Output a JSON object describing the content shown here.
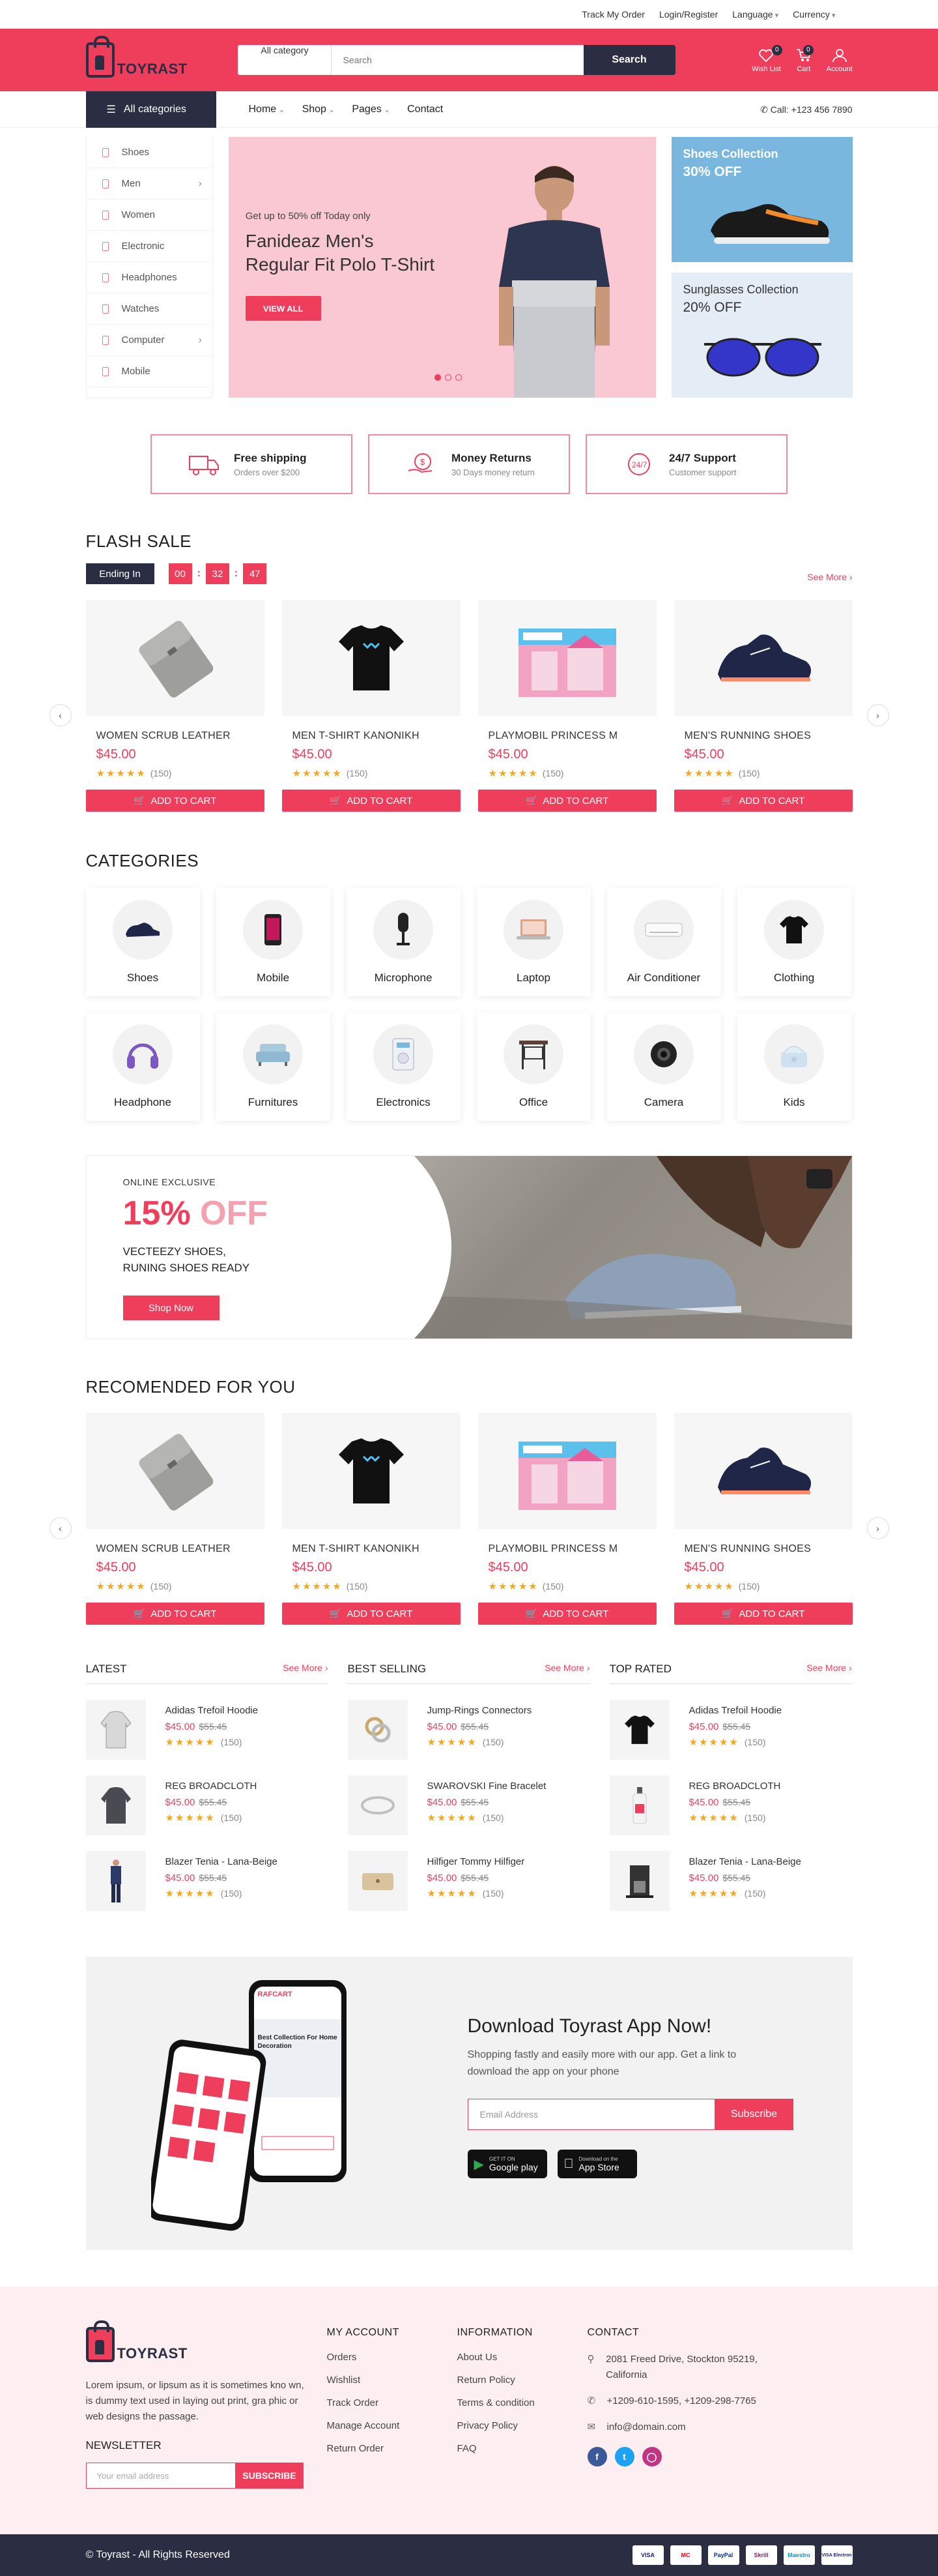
{
  "topbar": {
    "track": "Track My Order",
    "login": "Login/Register",
    "language": "Language",
    "currency": "Currency"
  },
  "header": {
    "brand": "TOYRAST",
    "category_label": "All category",
    "search_placeholder": "Search",
    "search_button": "Search",
    "wishlist_label": "Wish List",
    "wishlist_count": "0",
    "cart_label": "Cart",
    "cart_count": "0",
    "account_label": "Account"
  },
  "nav": {
    "all_categories": "All categories",
    "items": [
      "Home",
      "Shop",
      "Pages",
      "Contact"
    ],
    "call": "Call: +123 456 7890"
  },
  "sidebar": [
    "Shoes",
    "Men",
    "Women",
    "Electronic",
    "Headphones",
    "Watches",
    "Computer",
    "Mobile"
  ],
  "hero": {
    "subtitle": "Get up to 50% off Today only",
    "title": "Fanideaz Men's Regular Fit Polo T-Shirt",
    "button": "VIEW ALL"
  },
  "promos": [
    {
      "title": "Shoes Collection",
      "offer": "30% OFF"
    },
    {
      "title": "Sunglasses Collection",
      "offer": "20% OFF"
    }
  ],
  "services": [
    {
      "title": "Free shipping",
      "sub": "Orders over $200"
    },
    {
      "title": "Money Returns",
      "sub": "30 Days money return"
    },
    {
      "title": "24/7 Support",
      "sub": "Customer support"
    }
  ],
  "flash": {
    "title": "FLASH SALE",
    "ending": "Ending In",
    "h": "00",
    "m": "32",
    "s": "47",
    "see_more": "See More"
  },
  "products": [
    {
      "name": "WOMEN SCRUB LEATHER",
      "price": "$45.00",
      "reviews": "(150)",
      "button": "ADD TO CART"
    },
    {
      "name": "MEN T-SHIRT KANONIKH",
      "price": "$45.00",
      "reviews": "(150)",
      "button": "ADD TO CART"
    },
    {
      "name": "PLAYMOBIL PRINCESS M",
      "price": "$45.00",
      "reviews": "(150)",
      "button": "ADD TO CART"
    },
    {
      "name": "MEN'S RUNNING SHOES",
      "price": "$45.00",
      "reviews": "(150)",
      "button": "ADD TO CART"
    }
  ],
  "categories_title": "CATEGORIES",
  "categories": [
    "Shoes",
    "Mobile",
    "Microphone",
    "Laptop",
    "Air Conditioner",
    "Clothing",
    "Headphone",
    "Furnitures",
    "Electronics",
    "Office",
    "Camera",
    "Kids"
  ],
  "exclusive": {
    "label": "ONLINE EXCLUSIVE",
    "pct": "15%",
    "off": " OFF",
    "text": "VECTEEZY SHOES, RUNING SHOES READY",
    "button": "Shop Now"
  },
  "recommended_title": "RECOMENDED FOR YOU",
  "lists": [
    {
      "title": "LATEST",
      "see": "See More",
      "items": [
        {
          "name": "Adidas Trefoil Hoodie",
          "price": "$45.00",
          "old": "$55.45",
          "reviews": "(150)"
        },
        {
          "name": "REG BROADCLOTH",
          "price": "$45.00",
          "old": "$55.45",
          "reviews": "(150)"
        },
        {
          "name": "Blazer Tenia - Lana-Beige",
          "price": "$45.00",
          "old": "$55.45",
          "reviews": "(150)"
        }
      ]
    },
    {
      "title": "BEST SELLING",
      "see": "See More",
      "items": [
        {
          "name": "Jump-Rings Connectors",
          "price": "$45.00",
          "old": "$55.45",
          "reviews": "(150)"
        },
        {
          "name": "SWAROVSKI Fine Bracelet",
          "price": "$45.00",
          "old": "$55.45",
          "reviews": "(150)"
        },
        {
          "name": "Hilfiger Tommy Hilfiger",
          "price": "$45.00",
          "old": "$55.45",
          "reviews": "(150)"
        }
      ]
    },
    {
      "title": "TOP RATED",
      "see": "See More",
      "items": [
        {
          "name": "Adidas Trefoil Hoodie",
          "price": "$45.00",
          "old": "$55.45",
          "reviews": "(150)"
        },
        {
          "name": "REG BROADCLOTH",
          "price": "$45.00",
          "old": "$55.45",
          "reviews": "(150)"
        },
        {
          "name": "Blazer Tenia - Lana-Beige",
          "price": "$45.00",
          "old": "$55.45",
          "reviews": "(150)"
        }
      ]
    }
  ],
  "app": {
    "title": "Download Toyrast App Now!",
    "text": "Shopping fastly and easily more with our app. Get a link to download the app on your phone",
    "email_placeholder": "Email Address",
    "subscribe": "Subscribe",
    "google_small": "GET IT ON",
    "google": "Google play",
    "apple_small": "Download on the",
    "apple": "App Store",
    "phone_brand": "RAFCART",
    "phone_text": "Best Collection For Home Decoration"
  },
  "footer": {
    "brand": "TOYRAST",
    "about": "Lorem ipsum, or lipsum as it is sometimes kno wn, is dummy text used in laying out print, gra phic or web designs the passage.",
    "newsletter": "NEWSLETTER",
    "nl_placeholder": "Your email address",
    "nl_button": "SUBSCRIBE",
    "account_title": "MY ACCOUNT",
    "account": [
      "Orders",
      "Wishlist",
      "Track Order",
      "Manage Account",
      "Return Order"
    ],
    "info_title": "INFORMATION",
    "info": [
      "About Us",
      "Return Policy",
      "Terms & condition",
      "Privacy Policy",
      "FAQ"
    ],
    "contact_title": "CONTACT",
    "address": "2081 Freed Drive, Stockton 95219, California",
    "phone": "+1209-610-1595, +1209-298-7765",
    "email": "info@domain.com",
    "copyright": "© Toyrast - All Rights Reserved",
    "payments": [
      "VISA",
      "MC",
      "PayPal",
      "Skrill",
      "Maestro",
      "VISA Electron"
    ]
  },
  "colors": {
    "accent": "#ef3e5c",
    "dark": "#2b2d42"
  }
}
